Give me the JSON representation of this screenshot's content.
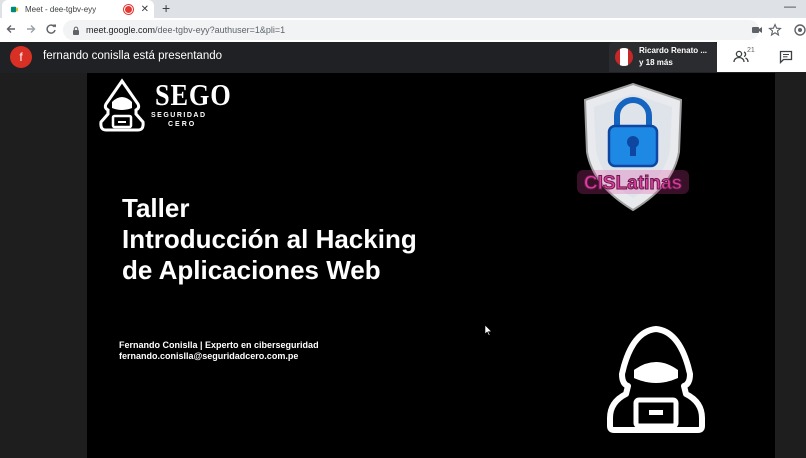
{
  "browser": {
    "tab_title": "Meet - dee-tgbv-eyy",
    "tab_close": "✕",
    "new_tab": "+",
    "minimize": "—",
    "url_host": "meet.google.com",
    "url_path": "/dee-tgbv-eyy?authuser=1&pli=1"
  },
  "meet": {
    "presenter_initial": "f",
    "presenting_text": "fernando conislla está presentando",
    "participant_name": "Ricardo Renato ...",
    "participant_more": "y 18 más",
    "people_count": "21"
  },
  "slide": {
    "logo_name": "SEGO",
    "logo_sub1": "SEGURIDAD",
    "logo_sub2": "CERO",
    "cis_text": "CISLatinas",
    "title_lines": [
      "Taller",
      "Introducción al Hacking",
      "de Aplicaciones Web"
    ],
    "author_line": "Fernando Conislla | Experto en ciberseguridad",
    "author_email": "fernando.conislla@seguridadcero.com.pe"
  },
  "colors": {
    "presenter_avatar": "#d93025",
    "slide_background": "#000000",
    "cis_pink": "#e040a0",
    "cis_blue": "#1e88e5"
  }
}
